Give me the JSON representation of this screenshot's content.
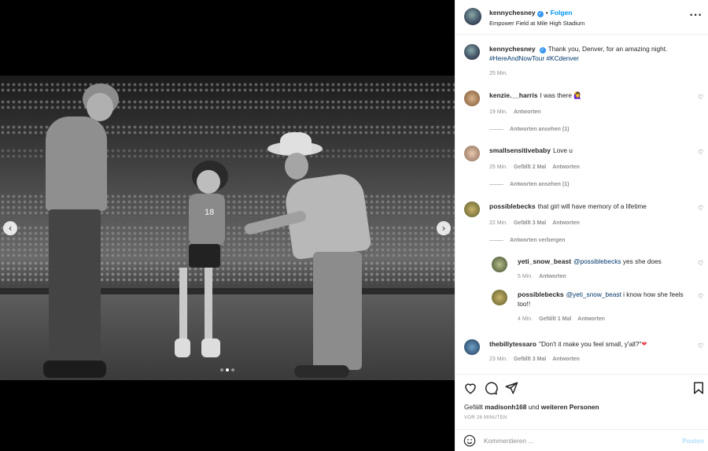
{
  "header": {
    "username": "kennychesney",
    "follow_label": "Folgen",
    "location": "Empower Field at Mile High Stadium",
    "more_icon": "more-horizontal-icon"
  },
  "caption": {
    "username": "kennychesney",
    "text": "Thank you, Denver, for an amazing night. ",
    "hashtag1": "#HereAndNowTour",
    "hashtag2": "#KCdenver",
    "time": "25 Min."
  },
  "comments": [
    {
      "username": "kenzie.__harris",
      "text": "I was there ",
      "emoji": "🙋‍♀️",
      "time": "19 Min.",
      "likes": "",
      "reply": "Antworten",
      "replies_toggle": "Antworten ansehen (1)"
    },
    {
      "username": "smallsensitivebaby",
      "text": "Love u",
      "time": "25 Min.",
      "likes": "Gefällt 2 Mal",
      "reply": "Antworten",
      "replies_toggle": "Antworten ansehen (1)"
    },
    {
      "username": "possiblebecks",
      "text": "that girl will have memory of a lifetime",
      "time": "22 Min.",
      "likes": "Gefällt 3 Mal",
      "reply": "Antworten",
      "replies_toggle": "Antworten verbergen"
    },
    {
      "username": "yeti_snow_beast",
      "mention": "@possiblebecks",
      "text": " yes she does",
      "time": "5 Min.",
      "reply": "Antworten"
    },
    {
      "username": "possiblebecks",
      "mention": "@yeti_snow_beast",
      "text": " i know how she feels too!!",
      "time": "4 Min.",
      "likes": "Gefällt 1 Mal",
      "reply": "Antworten"
    },
    {
      "username": "thebillytessaro",
      "text": "\"Don't it make you feel small, y'all?\"",
      "emoji": "❤",
      "time": "23 Min.",
      "likes": "Gefällt 3 Mal",
      "reply": "Antworten"
    }
  ],
  "actions": {
    "likes_prefix": "Gefällt ",
    "likes_user": "madisonh168",
    "likes_mid": " und ",
    "likes_others": "weiteren Personen",
    "time_ago": "VOR 26 MINUTEN"
  },
  "composer": {
    "placeholder": "Kommentieren ...",
    "post_label": "Posten"
  },
  "media": {
    "slide_count": 3,
    "active_slide": 2,
    "prev_icon": "chevron-left-icon",
    "next_icon": "chevron-right-icon",
    "jersey_number": "18"
  },
  "colors": {
    "link": "#00376b",
    "follow": "#0095f6",
    "verified": "#3897f0",
    "muted": "#8e8e8e",
    "post_disabled": "#b2dffc"
  }
}
